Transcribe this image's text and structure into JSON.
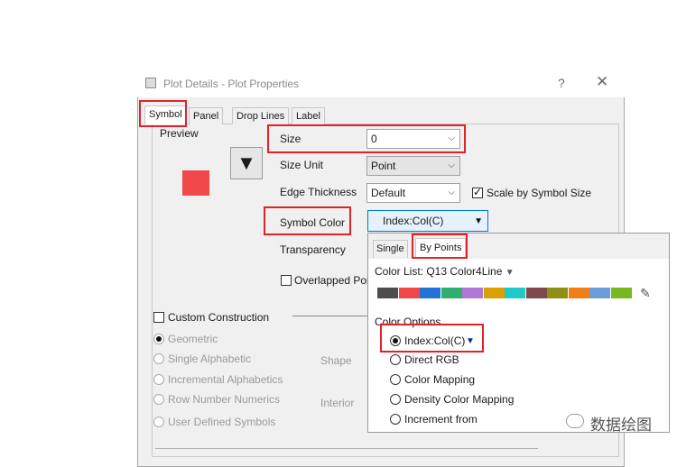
{
  "window": {
    "title": "Plot Details - Plot Properties",
    "help": "?",
    "close": "✕"
  },
  "tabs": [
    {
      "label": "Symbol",
      "active": true
    },
    {
      "label": "Panel",
      "active": false
    },
    {
      "label": "Drop Lines",
      "active": false
    },
    {
      "label": "Label",
      "active": false
    }
  ],
  "preview": {
    "label": "Preview",
    "marker_color": "#f04848",
    "shape_glyph": "▼"
  },
  "fields": {
    "size_label": "Size",
    "size_value": "0",
    "size_unit_label": "Size Unit",
    "size_unit_value": "Point",
    "edge_thickness_label": "Edge Thickness",
    "edge_thickness_value": "Default",
    "scale_label": "Scale by Symbol Size",
    "scale_checked": true,
    "symbol_color_label": "Symbol Color",
    "symbol_color_value": "Index:Col(C)",
    "transparency_label": "Transparency",
    "overlapped_label": "Overlapped Poi"
  },
  "construction": {
    "custom_label": "Custom Construction",
    "options": [
      "Geometric",
      "Single Alphabetic",
      "Incremental Alphabetics",
      "Row Number Numerics",
      "User Defined Symbols"
    ],
    "shape_label": "Shape",
    "interior_label": "Interior"
  },
  "popup": {
    "tabs": [
      "Single",
      "By Points"
    ],
    "color_list_label": "Color List: Q13 Color4Line",
    "palette": [
      "#4d4d4d",
      "#f04848",
      "#2471d8",
      "#2fae6e",
      "#b077d9",
      "#d9a000",
      "#1fc9c9",
      "#7c4a4a",
      "#8f8f14",
      "#f07f18",
      "#6b9ed8",
      "#78b81e"
    ],
    "options_label": "Color Options",
    "options": [
      "Index:Col(C)",
      "Direct RGB",
      "Color Mapping",
      "Density Color Mapping",
      "Increment from"
    ]
  },
  "watermark": {
    "text": "数据绘图"
  },
  "colors": {
    "highlight": "#e2222a",
    "accent": "#0a2f9c"
  }
}
